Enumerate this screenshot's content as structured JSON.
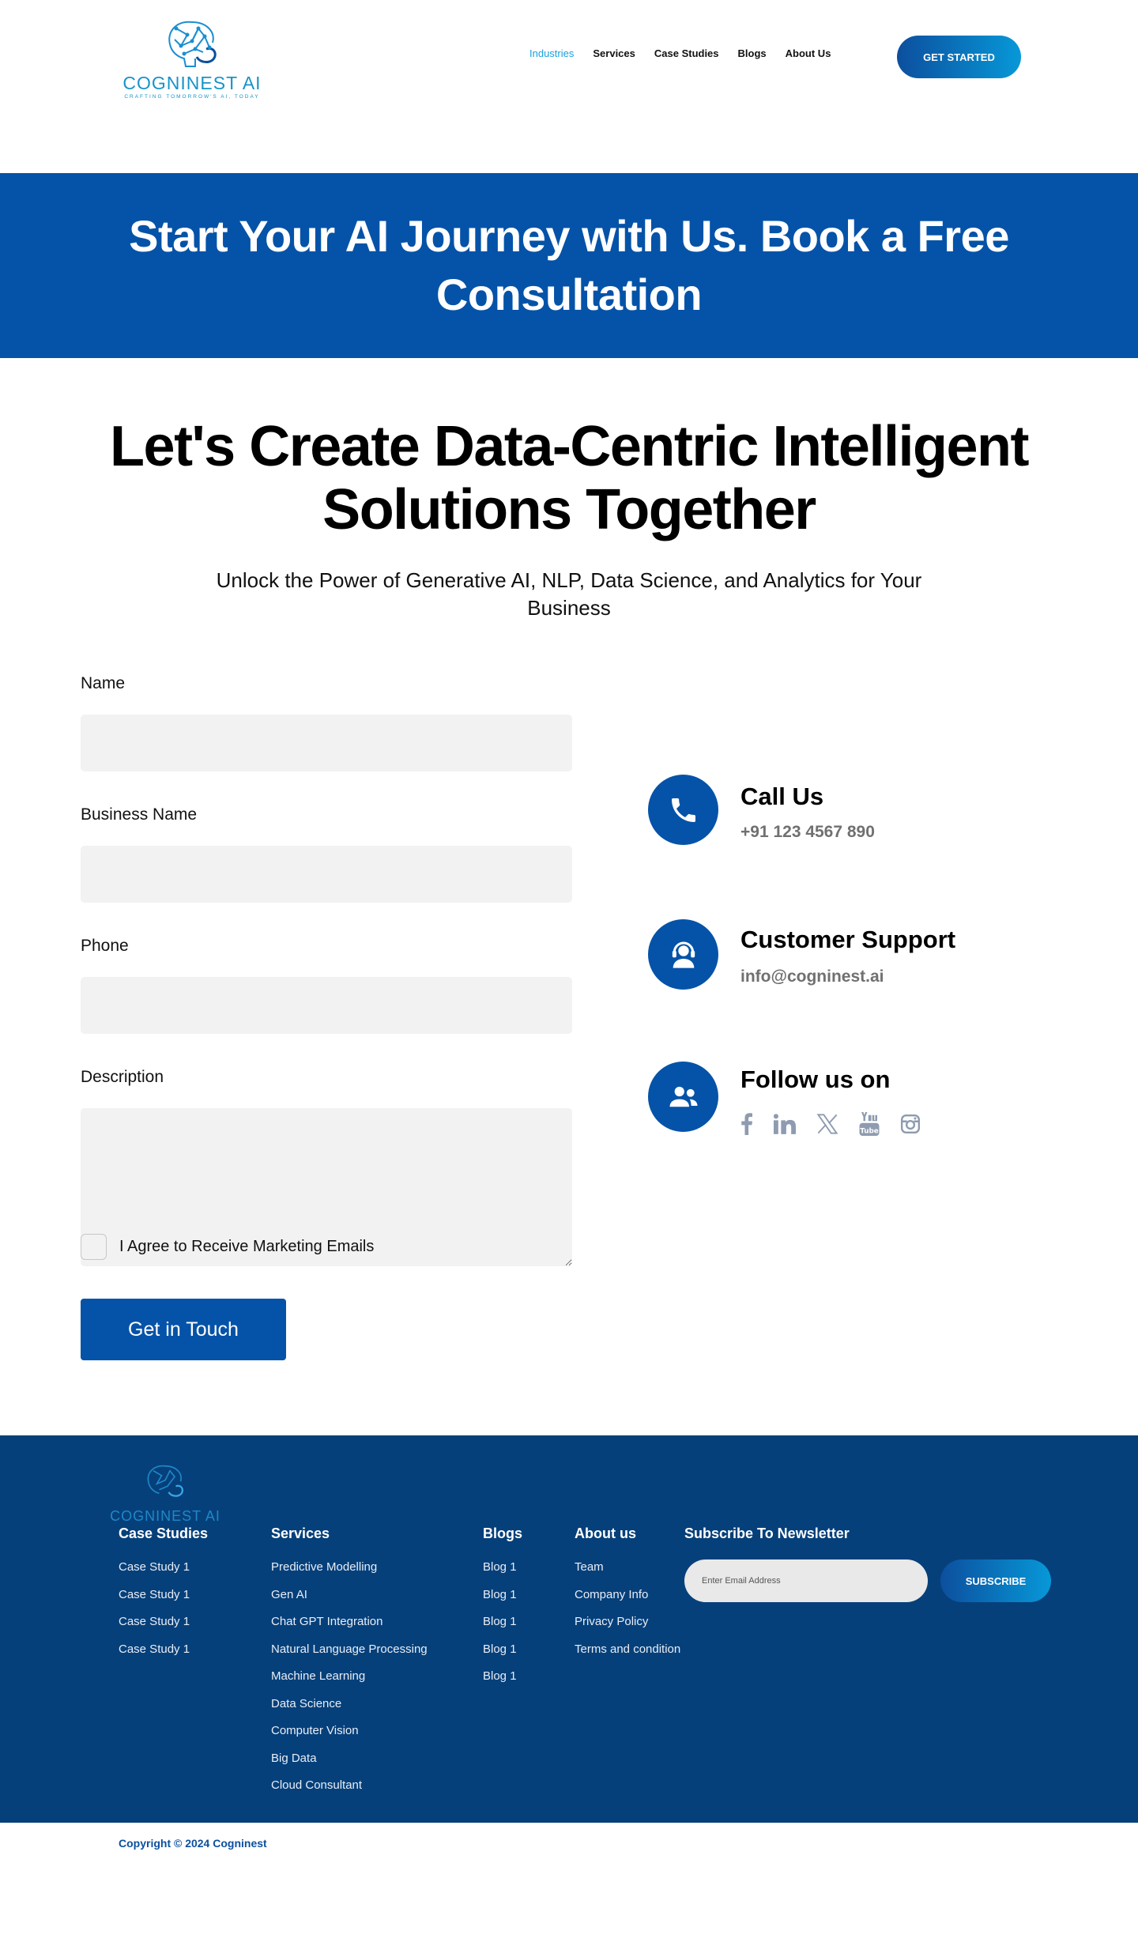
{
  "header": {
    "logo_name": "COGNINEST AI",
    "logo_tagline": "CRAFTING TOMORROW'S AI, TODAY",
    "nav": [
      "Industries",
      "Services",
      "Case Studies",
      "Blogs",
      "About Us"
    ],
    "cta": "GET STARTED"
  },
  "hero": {
    "title": "Start Your AI Journey with Us. Book a Free Consultation"
  },
  "intro": {
    "title": "Let's Create Data-Centric Intelligent Solutions Together",
    "subtitle": "Unlock the Power of Generative AI, NLP, Data Science, and Analytics for Your Business"
  },
  "form": {
    "name_label": "Name",
    "business_label": "Business Name",
    "phone_label": "Phone",
    "description_label": "Description",
    "agree_label": "I Agree to Receive Marketing Emails",
    "submit_label": "Get in Touch"
  },
  "contact": {
    "call_title": "Call Us",
    "call_value": "+91 123 4567 890",
    "support_title": "Customer Support",
    "support_value": "info@cogninest.ai",
    "follow_title": "Follow us on",
    "icons": [
      "phone-icon",
      "headset-icon",
      "users-icon"
    ],
    "socials": [
      "facebook-icon",
      "linkedin-icon",
      "x-icon",
      "youtube-icon",
      "instagram-icon"
    ]
  },
  "footer": {
    "logo_name": "COGNINEST AI",
    "case_studies": {
      "title": "Case Studies",
      "items": [
        "Case Study 1",
        "Case Study 1",
        "Case Study 1",
        "Case Study 1"
      ]
    },
    "services": {
      "title": "Services",
      "items": [
        "Predictive Modelling",
        "Gen AI",
        "Chat GPT Integration",
        "Natural Language Processing",
        "Machine Learning",
        "Data Science",
        "Computer Vision",
        "Big Data",
        "Cloud Consultant"
      ]
    },
    "blogs": {
      "title": "Blogs",
      "items": [
        "Blog 1",
        "Blog 1",
        "Blog 1",
        "Blog 1",
        "Blog 1"
      ]
    },
    "about": {
      "title": "About us",
      "items": [
        "Team",
        "Company Info",
        "Privacy Policy",
        "Terms and condition"
      ]
    },
    "newsletter": {
      "title": "Subscribe To Newsletter",
      "placeholder": "Enter Email Address",
      "button": "SUBSCRIBE"
    }
  },
  "copyright": "Copyright © 2024 Cogninest",
  "colors": {
    "primary": "#0553a8",
    "footer": "#06407a",
    "accent": "#1aa1dc"
  }
}
